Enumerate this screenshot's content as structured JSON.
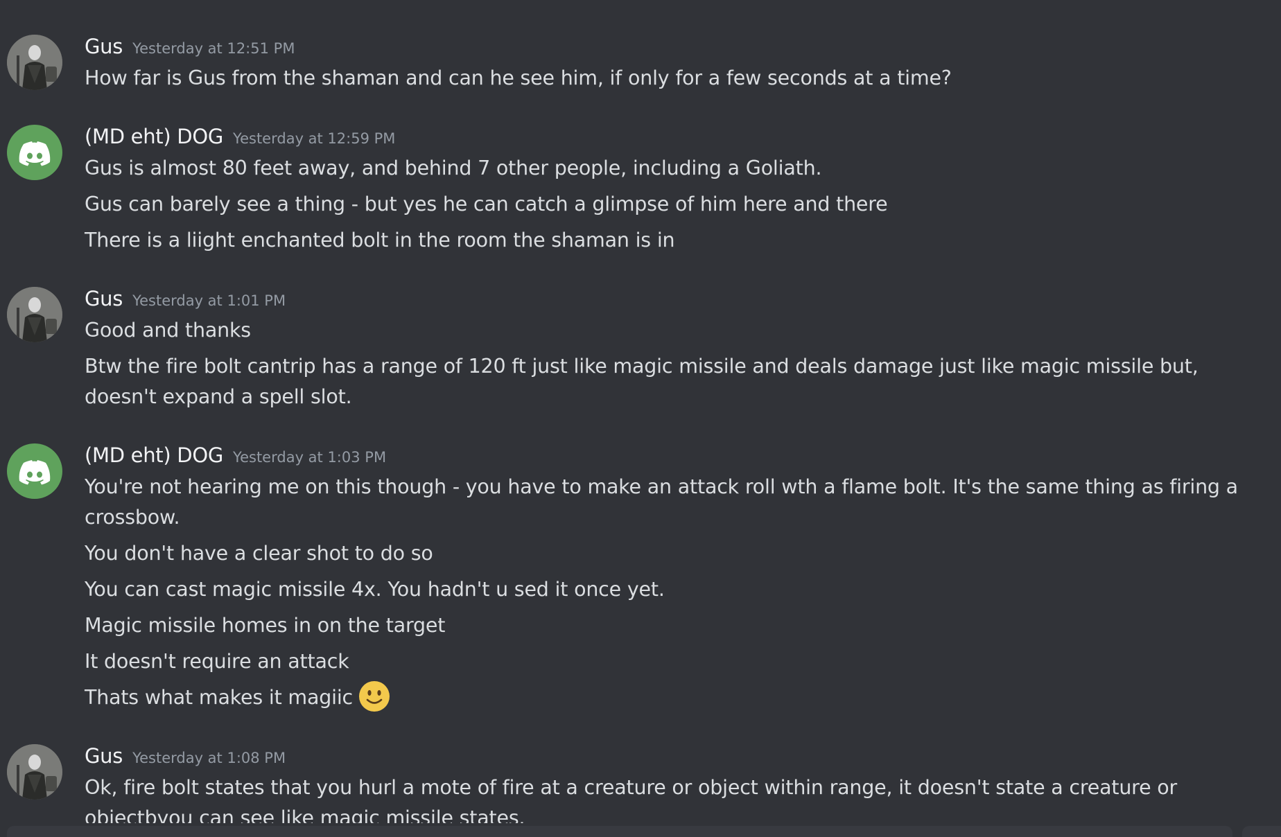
{
  "messages": [
    {
      "author": "Gus",
      "avatar": "gus-avatar",
      "timestamp": "Yesterday at 12:51 PM",
      "lines": [
        "How far is Gus from the shaman and can he see him, if only for a few seconds at a time?"
      ]
    },
    {
      "author": "(MD eht) DOG",
      "avatar": "discord-logo-icon",
      "timestamp": "Yesterday at 12:59 PM",
      "lines": [
        "Gus is almost 80 feet away, and behind 7 other people, including a Goliath.",
        "Gus can barely see a thing - but yes he can catch a glimpse of him here and there",
        "There is a liight enchanted bolt in the room the shaman is in"
      ]
    },
    {
      "author": "Gus",
      "avatar": "gus-avatar",
      "timestamp": "Yesterday at 1:01 PM",
      "lines": [
        "Good and thanks",
        "Btw the fire bolt cantrip has a range of 120 ft just like magic missile and deals damage just like magic missile but, doesn't expand a spell slot."
      ]
    },
    {
      "author": "(MD eht) DOG",
      "avatar": "discord-logo-icon",
      "timestamp": "Yesterday at 1:03 PM",
      "lines": [
        "You're not hearing me on this though - you have to make an attack roll wth a flame bolt. It's the same thing as firing a crossbow.",
        "You don't have a clear shot to do so",
        "You can cast magic missile 4x.  You hadn't u sed it once yet.",
        "Magic missile homes in on the target",
        "It doesn't require an attack",
        "Thats what makes it magiic"
      ]
    },
    {
      "author": "Gus",
      "avatar": "gus-avatar",
      "timestamp": "Yesterday at 1:08 PM",
      "lines": [
        "Ok, fire bolt states that you hurl a mote of fire at a creature or object within range, it doesn't state a creature or objectbyou can see like magic missile states."
      ]
    }
  ],
  "colors": {
    "background": "#313338",
    "username": "#f2f3f5",
    "timestamp": "#949ba4",
    "text": "#dbdee1",
    "discord_avatar": "#5fa25c"
  }
}
